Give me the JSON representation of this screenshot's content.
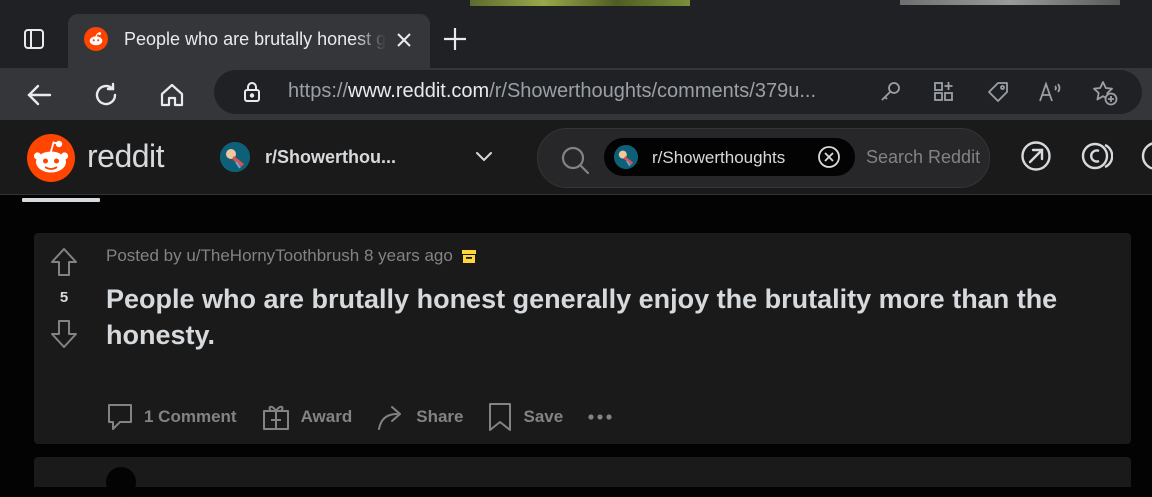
{
  "browser": {
    "tab": {
      "title": "People who are brutally honest generally enjoy the brutality more than the honesty."
    },
    "address": {
      "url_scheme": "https://",
      "url_domain": "www.reddit.com",
      "url_path": "/r/Showerthoughts/comments/379u..."
    }
  },
  "reddit": {
    "wordmark": "reddit",
    "community_switcher": {
      "label": "r/Showerthou..."
    },
    "search": {
      "chip_label": "r/Showerthoughts",
      "placeholder": "Search Reddit"
    }
  },
  "post": {
    "vote_count": "5",
    "meta": "Posted by u/TheHornyToothbrush 8 years ago",
    "title": "People who are brutally honest generally enjoy the brutality more than the honesty.",
    "actions": {
      "comments": "1 Comment",
      "award": "Award",
      "share": "Share",
      "save": "Save"
    }
  },
  "colors": {
    "reddit_orange": "#ff4500",
    "archive_badge": "#ffd635",
    "page_bg": "#030303",
    "card_bg": "#1a1a1b"
  }
}
